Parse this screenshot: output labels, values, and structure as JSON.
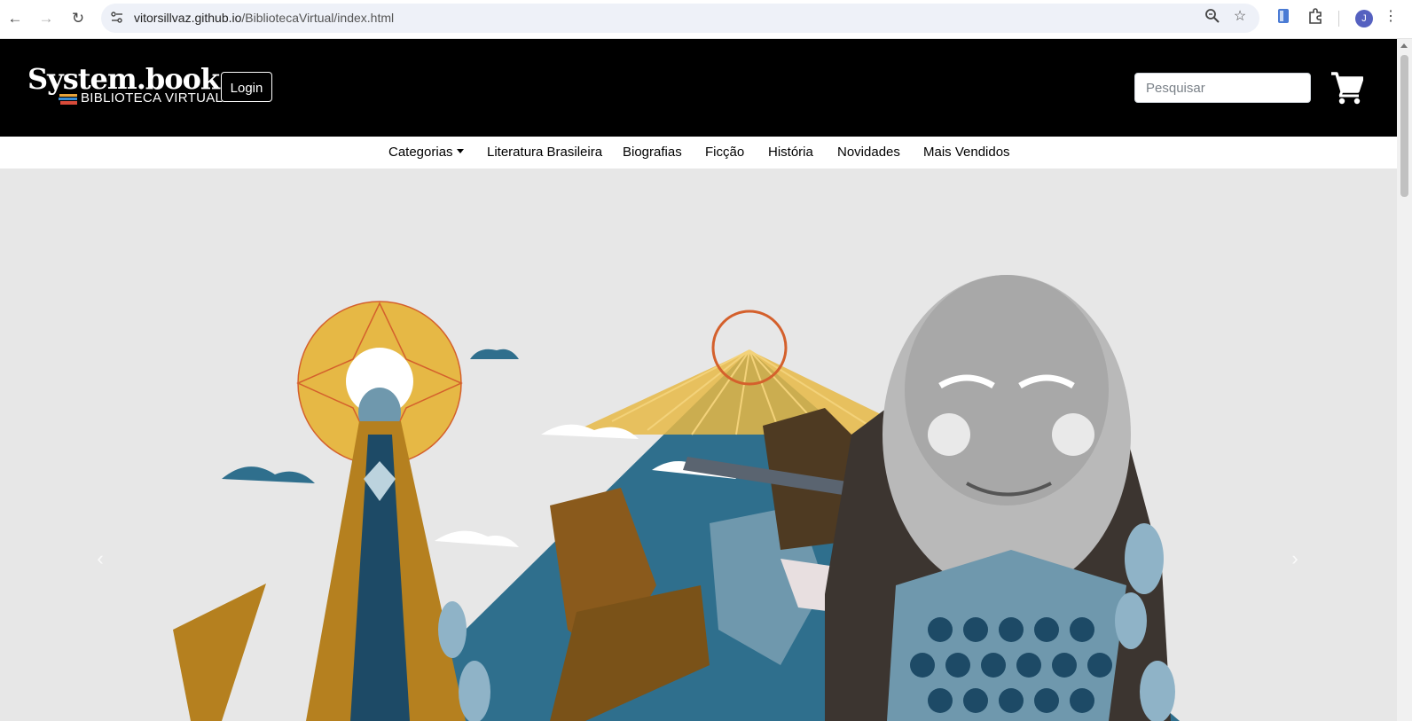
{
  "browser": {
    "url_host": "vitorsillvaz.github.io",
    "url_path": "/BibliotecaVirtual/index.html",
    "profile_initial": "J"
  },
  "header": {
    "logo_title": "System.book",
    "logo_subtitle": "BIBLIOTECA VIRTUAL",
    "login_label": "Login",
    "search_placeholder": "Pesquisar"
  },
  "nav": {
    "categories_label": "Categorias",
    "items": [
      "Literatura Brasileira",
      "Biografias",
      "Ficção",
      "História",
      "Novidades",
      "Mais Vendidos"
    ]
  },
  "carousel": {
    "prev_icon": "chevron-left-icon",
    "next_icon": "chevron-right-icon"
  },
  "colors": {
    "header_bg": "#000000",
    "carousel_bg": "#e7e7e7",
    "illustration_blue": "#2f6f8d",
    "illustration_ochre": "#b5801f",
    "illustration_gold": "#e6b845"
  }
}
